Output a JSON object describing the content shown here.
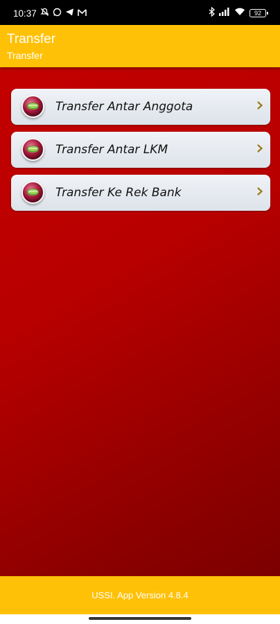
{
  "status_bar": {
    "time": "10:37",
    "battery": "92",
    "icons_left": [
      "mute-icon",
      "whatsapp-icon",
      "telegram-icon",
      "gmail-icon"
    ],
    "icons_right": [
      "bluetooth-icon",
      "signal-icon",
      "wifi-icon",
      "battery-icon"
    ]
  },
  "header": {
    "title": "Transfer",
    "subtitle": "Transfer",
    "color": "#FFC107"
  },
  "menu": {
    "items": [
      {
        "label": "Transfer Antar Anggota",
        "icon": "transfer-coin-icon"
      },
      {
        "label": "Transfer Antar LKM",
        "icon": "transfer-coin-icon"
      },
      {
        "label": "Transfer Ke Rek Bank",
        "icon": "transfer-coin-icon"
      }
    ]
  },
  "footer": {
    "version_text": "USSI. App Version 4.8.4"
  },
  "colors": {
    "accent": "#FFC107",
    "background_red": "#C30000",
    "chevron": "#9A7A1A"
  }
}
